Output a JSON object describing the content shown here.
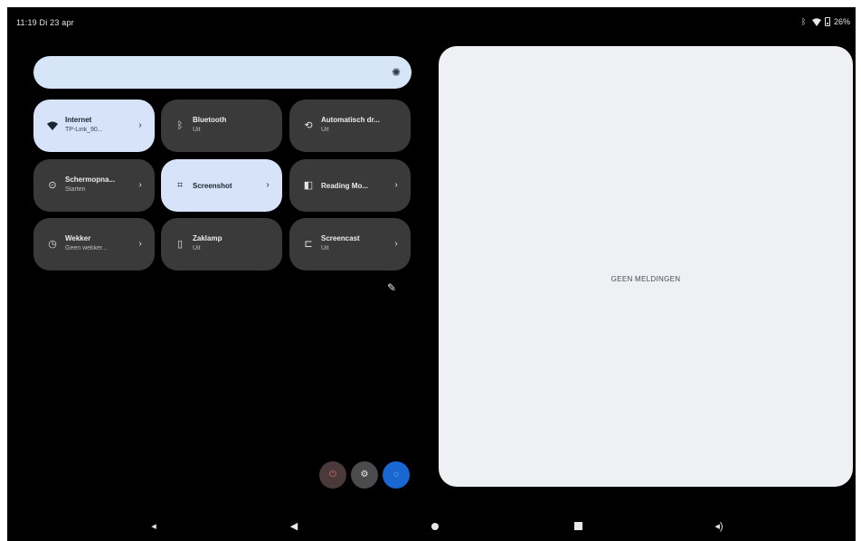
{
  "status_bar": {
    "time": "11:19 Di 23 apr",
    "battery_text": "26%",
    "icons": [
      "bluetooth-icon",
      "wifi-icon",
      "battery-icon"
    ]
  },
  "brightness": {
    "icon": "brightness-icon",
    "accent": "#d7e5f9"
  },
  "tiles": [
    {
      "title": "Internet",
      "subtitle": "TP-Link_90...",
      "icon": "wifi-icon",
      "active": true
    },
    {
      "title": "Bluetooth",
      "subtitle": "Uit",
      "icon": "bluetooth-icon",
      "active": false
    },
    {
      "title": "Automatisch dr...",
      "subtitle": "Uit",
      "icon": "rotate-icon",
      "active": false
    },
    {
      "title": "Schermopna...",
      "subtitle": "Starten",
      "icon": "screen-record-icon",
      "active": false
    },
    {
      "title": "Screenshot",
      "subtitle": "",
      "icon": "screenshot-icon",
      "active": true
    },
    {
      "title": "Reading Mo...",
      "subtitle": "",
      "icon": "reading-mode-icon",
      "active": false
    },
    {
      "title": "Wekker",
      "subtitle": "Geen wekker...",
      "icon": "alarm-icon",
      "active": false
    },
    {
      "title": "Zaklamp",
      "subtitle": "Uit",
      "icon": "flashlight-icon",
      "active": false
    },
    {
      "title": "Screencast",
      "subtitle": "Uit",
      "icon": "cast-icon",
      "active": false
    }
  ],
  "notifications": {
    "empty_text": "GEEN MELDINGEN"
  },
  "footer_buttons": [
    "power-icon",
    "settings-icon",
    "user-icon"
  ],
  "nav": [
    "volume-down-icon",
    "back-icon",
    "home-icon",
    "recents-icon",
    "volume-up-icon"
  ],
  "colors": {
    "active_tile": "#d6e3f9",
    "inactive_tile": "#3a3a3b",
    "user_button": "#1967d2",
    "panel_bg": "#eff0f4"
  }
}
